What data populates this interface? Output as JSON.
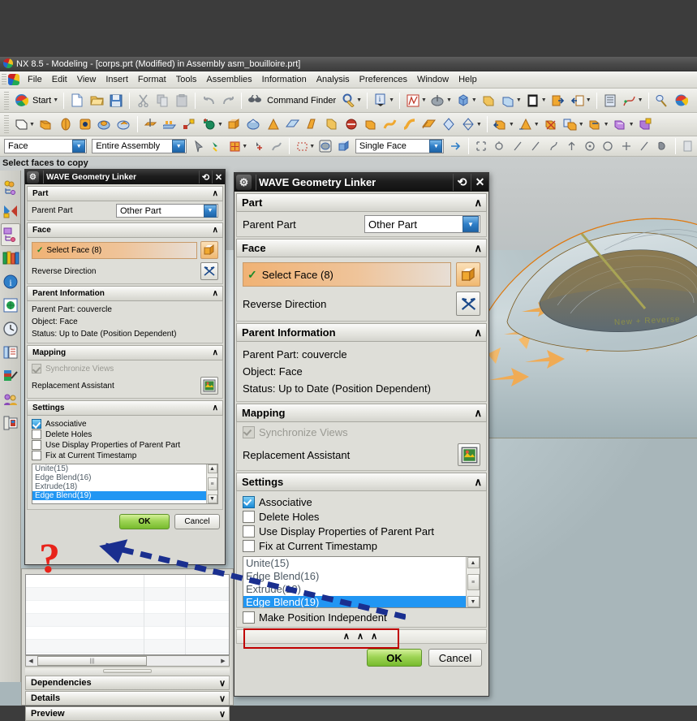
{
  "window": {
    "title": "NX 8.5 - Modeling - [corps.prt (Modified)  in Assembly asm_bouilloire.prt]",
    "logo_icon": "nx-logo-icon"
  },
  "menubar": {
    "app_icon": "nx-application-icon",
    "items": [
      {
        "label": "File"
      },
      {
        "label": "Edit"
      },
      {
        "label": "View"
      },
      {
        "label": "Insert"
      },
      {
        "label": "Format"
      },
      {
        "label": "Tools"
      },
      {
        "label": "Assemblies"
      },
      {
        "label": "Information"
      },
      {
        "label": "Analysis"
      },
      {
        "label": "Preferences"
      },
      {
        "label": "Window"
      },
      {
        "label": "Help"
      }
    ]
  },
  "standard_toolbar": {
    "start_label": "Start",
    "command_finder_label": "Command Finder",
    "icons": [
      "new-file-icon",
      "open-folder-icon",
      "save-icon",
      "cut-icon",
      "copy-icon",
      "paste-icon",
      "undo-icon",
      "redo-icon",
      "command-finder-icon",
      "customize-icon",
      "info-panel-icon",
      "sketch-icon",
      "datum-icon",
      "solid-body-icon",
      "shell-icon",
      "layer-icon",
      "window-icon",
      "enter-part-icon",
      "exit-part-icon",
      "assembly-navigator-icon",
      "curve-analysis-icon",
      "measure-icon",
      "wave-geometry-linker-icon"
    ]
  },
  "feature_toolbar": {
    "icons": [
      "sketch-plane-icon",
      "extrude-icon",
      "revolve-icon",
      "hole-icon",
      "boss-icon",
      "pad-icon",
      "datum-plane-icon",
      "pattern-feature-icon",
      "pattern-geometry-icon",
      "datum-csys-icon",
      "block-icon",
      "unite-icon",
      "edge-blend-icon",
      "chamfer-icon",
      "draft-icon",
      "shell-icon-2",
      "trim-body-icon",
      "offset-face-icon",
      "sweep-icon",
      "tube-icon",
      "thicken-icon",
      "divide-face-icon",
      "sew-icon",
      "patch-icon",
      "move-face-icon",
      "resize-blend-icon",
      "delete-face-icon",
      "copy-face-icon",
      "replace-face-icon",
      "offset-region-icon",
      "wave-linker-icon",
      "wave-interpart-icon"
    ]
  },
  "selection_bar": {
    "type_filter": {
      "value": "Face",
      "icon": "chevron-down-icon"
    },
    "scope_filter": {
      "value": "Entire Assembly",
      "icon": "chevron-down-icon"
    },
    "method_filter": {
      "value": "Single Face",
      "icon": "chevron-down-icon"
    },
    "icons": [
      "select-general-icon",
      "snap-point-icon",
      "selection-filter-icon",
      "quick-pick-icon",
      "rectangle-select-icon",
      "face-select-icon",
      "body-select-icon",
      "go-icon",
      "snap-end-icon",
      "snap-midpoint-icon",
      "snap-line-icon",
      "snap-arc-icon",
      "snap-quadrant-icon",
      "snap-center-icon",
      "snap-intersection-icon",
      "snap-tangent-icon",
      "snap-point2-icon",
      "snap-face-icon"
    ]
  },
  "cue_bar": {
    "text": "Select faces to copy"
  },
  "resource_bar": {
    "items": [
      {
        "name": "assembly-navigator-icon"
      },
      {
        "name": "constraint-navigator-icon"
      },
      {
        "name": "part-navigator-icon",
        "selected": true
      },
      {
        "name": "reuse-library-icon"
      },
      {
        "name": "html-help-icon"
      },
      {
        "name": "internet-explorer-icon"
      },
      {
        "name": "history-icon"
      },
      {
        "name": "process-studio-icon"
      },
      {
        "name": "roles-icon"
      },
      {
        "name": "system-scene-icon"
      },
      {
        "name": "web-export-icon"
      }
    ]
  },
  "navigator_panel": {
    "scroll_thumb_icon": "horizontal-scroll-thumb",
    "left_arrow_icon": "arrow-left-icon",
    "right_arrow_icon": "arrow-right-icon",
    "sections": [
      {
        "label": "Dependencies",
        "chevron": "∨"
      },
      {
        "label": "Details",
        "chevron": "∨"
      },
      {
        "label": "Preview",
        "chevron": "∨"
      }
    ]
  },
  "dialog_small": {
    "title": "WAVE Geometry Linker",
    "gear_icon": "dialog-options-icon",
    "reset_icon": "reset-icon",
    "close_icon": "close-icon",
    "groups": {
      "part": {
        "header": "Part",
        "chevron": "∧",
        "parent_part_label": "Parent Part",
        "parent_part_value": "Other Part",
        "dropdown_icon": "chevron-down-icon"
      },
      "face": {
        "header": "Face",
        "chevron": "∧",
        "select_face_label": "Select Face (8)",
        "select_face_check": "✓",
        "select_face_icon": "face-cube-icon",
        "reverse_direction_label": "Reverse Direction",
        "reverse_direction_icon": "reverse-direction-icon"
      },
      "parent_information": {
        "header": "Parent Information",
        "chevron": "∧",
        "lines": [
          "Parent Part: couvercle",
          "Object: Face",
          "Status: Up to Date (Position Dependent)"
        ]
      },
      "mapping": {
        "header": "Mapping",
        "chevron": "∧",
        "synchronize_views_label": "Synchronize Views",
        "replacement_assistant_label": "Replacement Assistant",
        "replacement_assistant_icon": "replacement-assistant-icon"
      },
      "settings": {
        "header": "Settings",
        "chevron": "∧",
        "checkboxes": [
          {
            "label": "Associative",
            "checked": true
          },
          {
            "label": "Delete Holes",
            "checked": false
          },
          {
            "label": "Use Display Properties of Parent Part",
            "checked": false
          },
          {
            "label": "Fix at Current Timestamp",
            "checked": false
          }
        ],
        "timestamp_list": [
          {
            "label": "Unite(15)",
            "selected": false
          },
          {
            "label": "Edge Blend(16)",
            "selected": false
          },
          {
            "label": "Extrude(18)",
            "selected": false
          },
          {
            "label": "Edge Blend(19)",
            "selected": true
          }
        ],
        "scroll_up_icon": "arrow-up-icon",
        "scroll_down_icon": "arrow-down-icon",
        "scroll_thumb_icon": "scroll-thumb-icon"
      }
    },
    "buttons": {
      "ok": "OK",
      "cancel": "Cancel"
    }
  },
  "dialog_large": {
    "title": "WAVE Geometry Linker",
    "gear_icon": "dialog-options-icon",
    "reset_icon": "reset-icon",
    "close_icon": "close-icon",
    "groups": {
      "part": {
        "header": "Part",
        "chevron": "∧",
        "parent_part_label": "Parent Part",
        "parent_part_value": "Other Part",
        "dropdown_icon": "chevron-down-icon"
      },
      "face": {
        "header": "Face",
        "chevron": "∧",
        "select_face_label": "Select Face (8)",
        "select_face_check": "✓",
        "select_face_icon": "face-cube-icon",
        "reverse_direction_label": "Reverse Direction",
        "reverse_direction_icon": "reverse-direction-icon"
      },
      "parent_information": {
        "header": "Parent Information",
        "chevron": "∧",
        "lines": [
          "Parent Part: couvercle",
          "Object: Face",
          "Status: Up to Date (Position Dependent)"
        ]
      },
      "mapping": {
        "header": "Mapping",
        "chevron": "∧",
        "synchronize_views_label": "Synchronize Views",
        "replacement_assistant_label": "Replacement Assistant",
        "replacement_assistant_icon": "replacement-assistant-icon"
      },
      "settings": {
        "header": "Settings",
        "chevron": "∧",
        "checkboxes": [
          {
            "label": "Associative",
            "checked": true
          },
          {
            "label": "Delete Holes",
            "checked": false
          },
          {
            "label": "Use Display Properties of Parent Part",
            "checked": false
          },
          {
            "label": "Fix at Current Timestamp",
            "checked": false
          }
        ],
        "timestamp_list": [
          {
            "label": "Unite(15)",
            "selected": false
          },
          {
            "label": "Edge Blend(16)",
            "selected": false
          },
          {
            "label": "Extrude(18)",
            "selected": false
          },
          {
            "label": "Edge Blend(19)",
            "selected": true
          }
        ],
        "make_position_independent_label": "Make Position Independent",
        "make_position_independent_checked": false,
        "scroll_up_icon": "arrow-up-icon",
        "scroll_down_icon": "arrow-down-icon",
        "scroll_thumb_icon": "scroll-thumb-icon"
      }
    },
    "expander": "∧ ∧ ∧",
    "buttons": {
      "ok": "OK",
      "cancel": "Cancel"
    }
  },
  "annotations": {
    "question_mark": "?",
    "arrow_name": "dashed-arrow-annotation",
    "highlight_color": "#c00000",
    "arrow_color": "#1a2f8f",
    "question_color": "#e8231a"
  },
  "viewport": {
    "label_text": "New + Reverse",
    "model_name": "couvercle-lid-model"
  }
}
